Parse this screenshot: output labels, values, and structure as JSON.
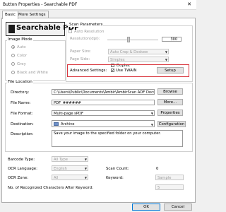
{
  "window": {
    "title": "Button Properties - Searchable PDF",
    "close_glyph": "✕"
  },
  "tabs": [
    {
      "label": "Basic"
    },
    {
      "label": "More Settings"
    }
  ],
  "logo": {
    "text": "Searchable PDF"
  },
  "image_mode": {
    "label": "Image Mode",
    "options": [
      {
        "label": "Auto",
        "selected": true
      },
      {
        "label": "Color"
      },
      {
        "label": "Grey"
      },
      {
        "label": "Black and White"
      }
    ]
  },
  "scan_parameters": {
    "label": "Scan Parameters",
    "auto_resolution_label": "Auto Resolution",
    "resolution_label": "Resolution(dpi):",
    "resolution_value": "300",
    "paper_size_label": "Paper Size:",
    "paper_size_value": "Auto Crop & Deskew",
    "page_side_label": "Page Side:",
    "page_side_value": "Simplex",
    "duplex_label": "Duplex",
    "advanced_settings_label": "Advanced Settings:",
    "use_twain_label": "Use TWAIN",
    "use_twain_checked": true,
    "setup_button": "Setup"
  },
  "file_location": {
    "label": "File Location",
    "directory_label": "Directory:",
    "directory_value": "C:\\Users\\Public\\Documents\\Ambir\\AmbirScan ADF Docs",
    "browse_button": "Browse",
    "file_name_label": "File Name:",
    "file_name_value": "PDF_######",
    "more_button": "More...",
    "file_format_label": "File Format:",
    "file_format_value": "Multi-page sPDF",
    "properties_button": "Properties",
    "destination_label": "Destination:",
    "destination_value": "Archive",
    "configuration_button": "Configuration",
    "description_label": "Description:",
    "description_value": "Save your image to the specified folder on your computer."
  },
  "barcode": {
    "barcode_type_label": "Barcode Type:",
    "barcode_type_value": "All Type",
    "ocr_language_label": "OCR Language:",
    "ocr_language_value": "English",
    "ocr_zone_label": "OCR Zone:",
    "ocr_zone_value": "All",
    "scan_count_label": "Scan Count:",
    "scan_count_value": "0",
    "keyword_label": "Keyword:",
    "keyword_value": "Sample",
    "recognized_label": "No. of Recognized Characters After Keyword:",
    "recognized_value": "5"
  },
  "footer": {
    "ok_button": "OK",
    "cancel_button": "Cancel"
  },
  "colors": {
    "highlight": "#d9363e",
    "logo_square": "#1b1b1b"
  }
}
